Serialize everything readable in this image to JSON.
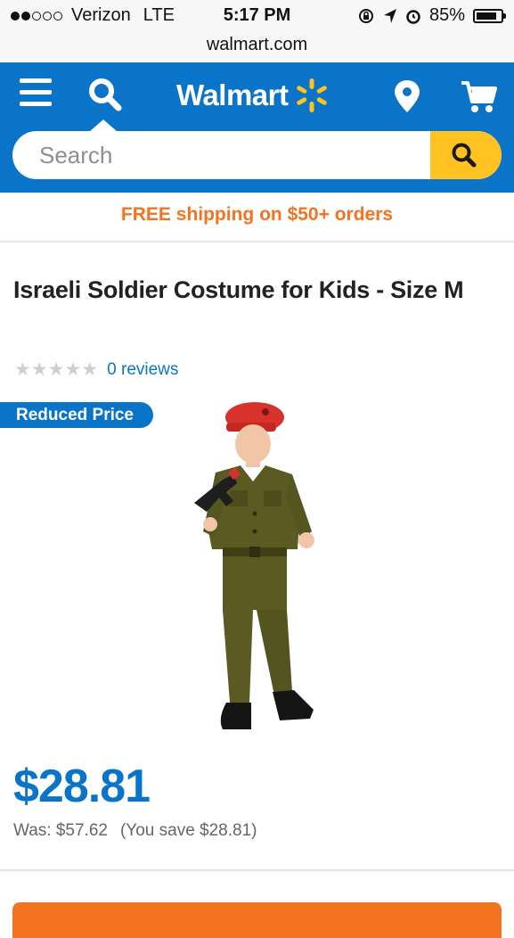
{
  "status": {
    "carrier": "Verizon",
    "network": "LTE",
    "time": "5:17 PM",
    "battery": "85%",
    "battery_level": 0.85
  },
  "browser": {
    "url": "walmart.com"
  },
  "header": {
    "brand": "Walmart",
    "search_placeholder": "Search",
    "icons": [
      "menu-icon",
      "search-icon",
      "spark-logo",
      "location-pin-icon",
      "cart-icon"
    ],
    "colors": {
      "brand_blue": "#0a74c9",
      "search_yellow": "#ffc220",
      "spark": "#ffc220"
    }
  },
  "promo": {
    "shipping": "FREE shipping on $50+ orders",
    "color": "#f47321"
  },
  "product": {
    "title": "Israeli Soldier Costume for Kids - Size M",
    "rating_stars": "★★★★★",
    "rating": 0,
    "reviews": "0 reviews",
    "badge": "Reduced Price",
    "price": "$28.81",
    "was": "Was: $57.62",
    "you_save": "(You save $28.81)"
  }
}
